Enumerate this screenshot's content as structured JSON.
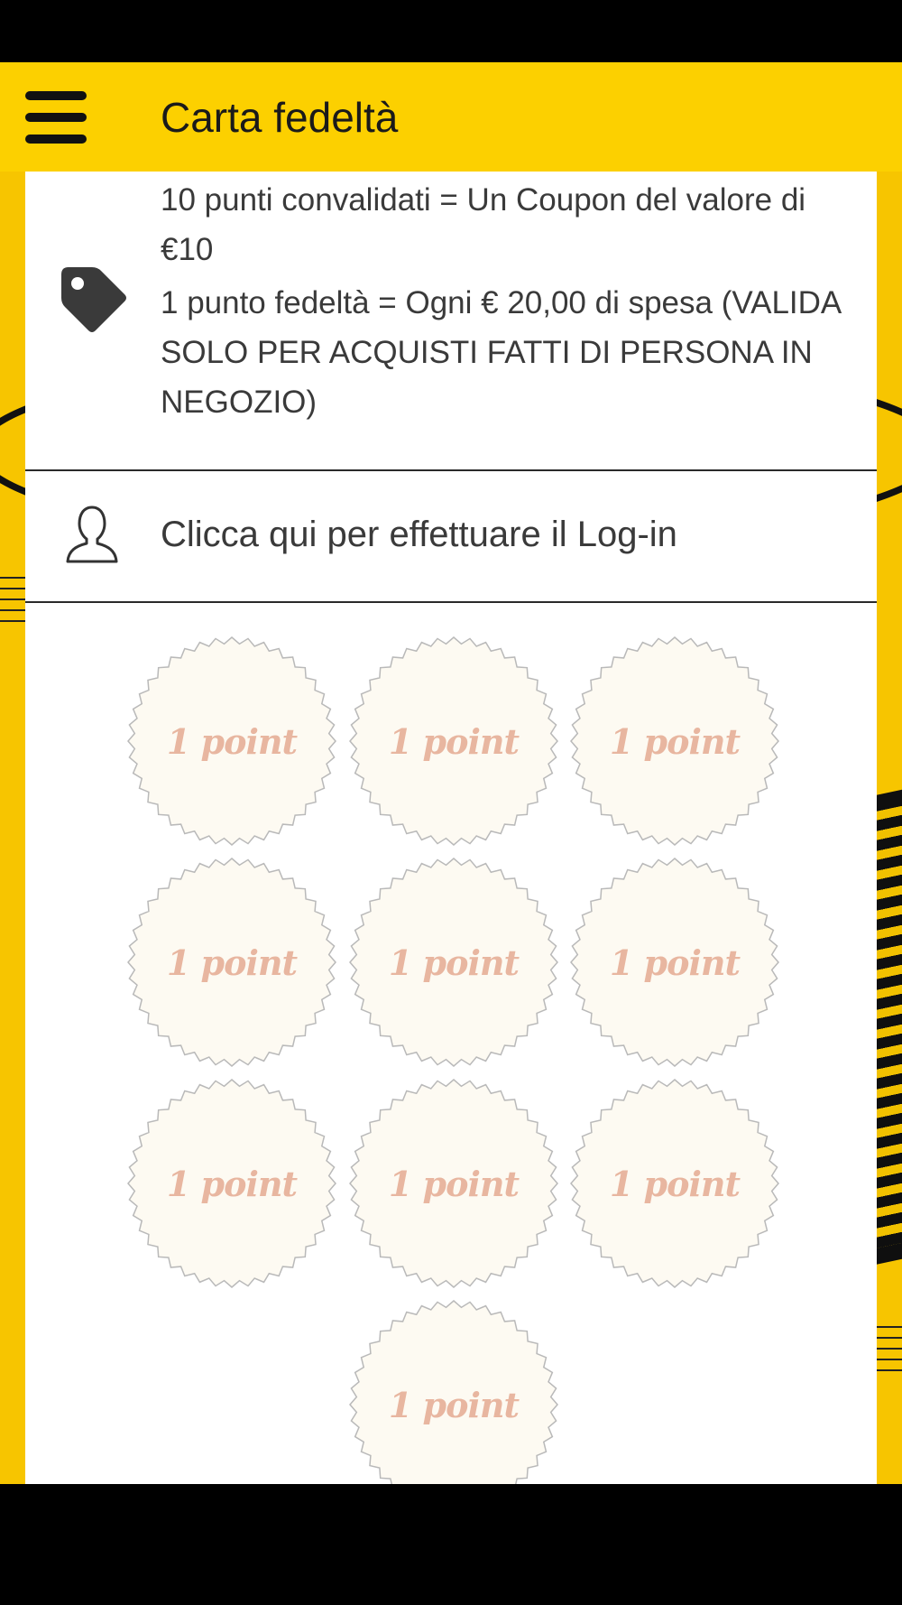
{
  "app_bar": {
    "title": "Carta fedeltà",
    "menu_icon": "hamburger-menu-icon",
    "color": "#fcd000"
  },
  "info": {
    "icon": "tag-icon",
    "line1": "10 punti convalidati = Un Coupon del valore di €10",
    "line2": "1 punto fedeltà = Ogni € 20,00 di spesa (VALIDA SOLO PER ACQUISTI FATTI DI PERSONA IN NEGOZIO)"
  },
  "login": {
    "icon": "user-icon",
    "label": "Clicca qui per effettuare il Log-in"
  },
  "stamps": {
    "label": "1 point",
    "count": 10,
    "fill_color": "#fdfaf2",
    "text_color": "#e8b6a0"
  }
}
